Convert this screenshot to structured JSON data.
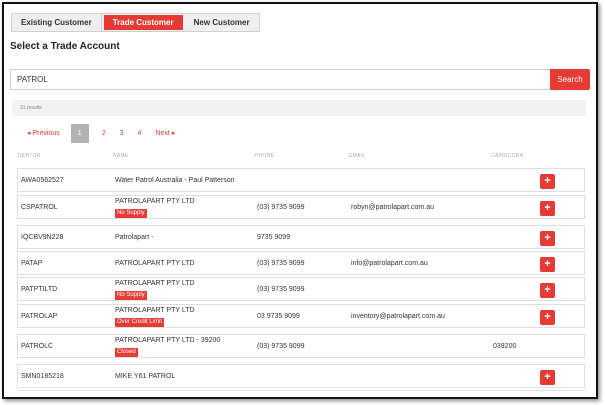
{
  "tabs": [
    {
      "label": "Existing Customer",
      "active": false
    },
    {
      "label": "Trade Customer",
      "active": true
    },
    {
      "label": "New Customer",
      "active": false
    }
  ],
  "heading": "Select a Trade Account",
  "search": {
    "value": "PATROL",
    "button_label": "Search"
  },
  "results_count": "31 results",
  "pagination": {
    "previous": "◂ Previous",
    "pages": [
      "1",
      "2",
      "3",
      "4"
    ],
    "current": "1",
    "next": "Next ▸"
  },
  "columns": [
    "DEBTOR",
    "NAME",
    "PHONE",
    "EMAIL",
    "CAPRICORN"
  ],
  "rows": [
    {
      "debtor": "AWA0562527",
      "name": "Water Patrol Australia - Paul Patterson",
      "badge": "",
      "phone": "",
      "email": "",
      "capricorn": "",
      "add": "+"
    },
    {
      "debtor": "CSPATROL",
      "name": "PATROLAPART PTY LTD",
      "badge": "No Supply",
      "phone": "(03) 9735 9099",
      "email": "robyn@patrolapart.com.au",
      "capricorn": "",
      "add": "+"
    },
    {
      "debtor": "IQCBV9N228",
      "name": "Patrolapart -",
      "badge": "",
      "phone": "9735 9099",
      "email": "",
      "capricorn": "",
      "add": "+"
    },
    {
      "debtor": "PATAP",
      "name": "PATROLAPART PTY LTD",
      "badge": "",
      "phone": "(03) 9735 9099",
      "email": "info@patrolapart.com.au",
      "capricorn": "",
      "add": "+"
    },
    {
      "debtor": "PATPTILTD",
      "name": "PATROLAPART PTY LTD",
      "badge": "No Supply",
      "phone": "(03) 9735 9099",
      "email": "",
      "capricorn": "",
      "add": "+"
    },
    {
      "debtor": "PATROLAP",
      "name": "PATROLAPART PTY LTD",
      "badge": "Over Credit Limit",
      "phone": "03 9735 9099",
      "email": "inventory@patrolapart.com.au",
      "capricorn": "",
      "add": "+"
    },
    {
      "debtor": "PATROLC",
      "name": "PATROLAPART PTY LTD - 39200",
      "badge": "Closed",
      "phone": "(03) 9735 9099",
      "email": "",
      "capricorn": "039200",
      "add": ""
    },
    {
      "debtor": "SMN0185218",
      "name": "MIKE Y61 PATROL",
      "badge": "",
      "phone": "",
      "email": "",
      "capricorn": "",
      "add": "+"
    }
  ],
  "colors": {
    "accent": "#e63b35",
    "tab_bg": "#efefef",
    "pager_current": "#b3b3b3"
  }
}
